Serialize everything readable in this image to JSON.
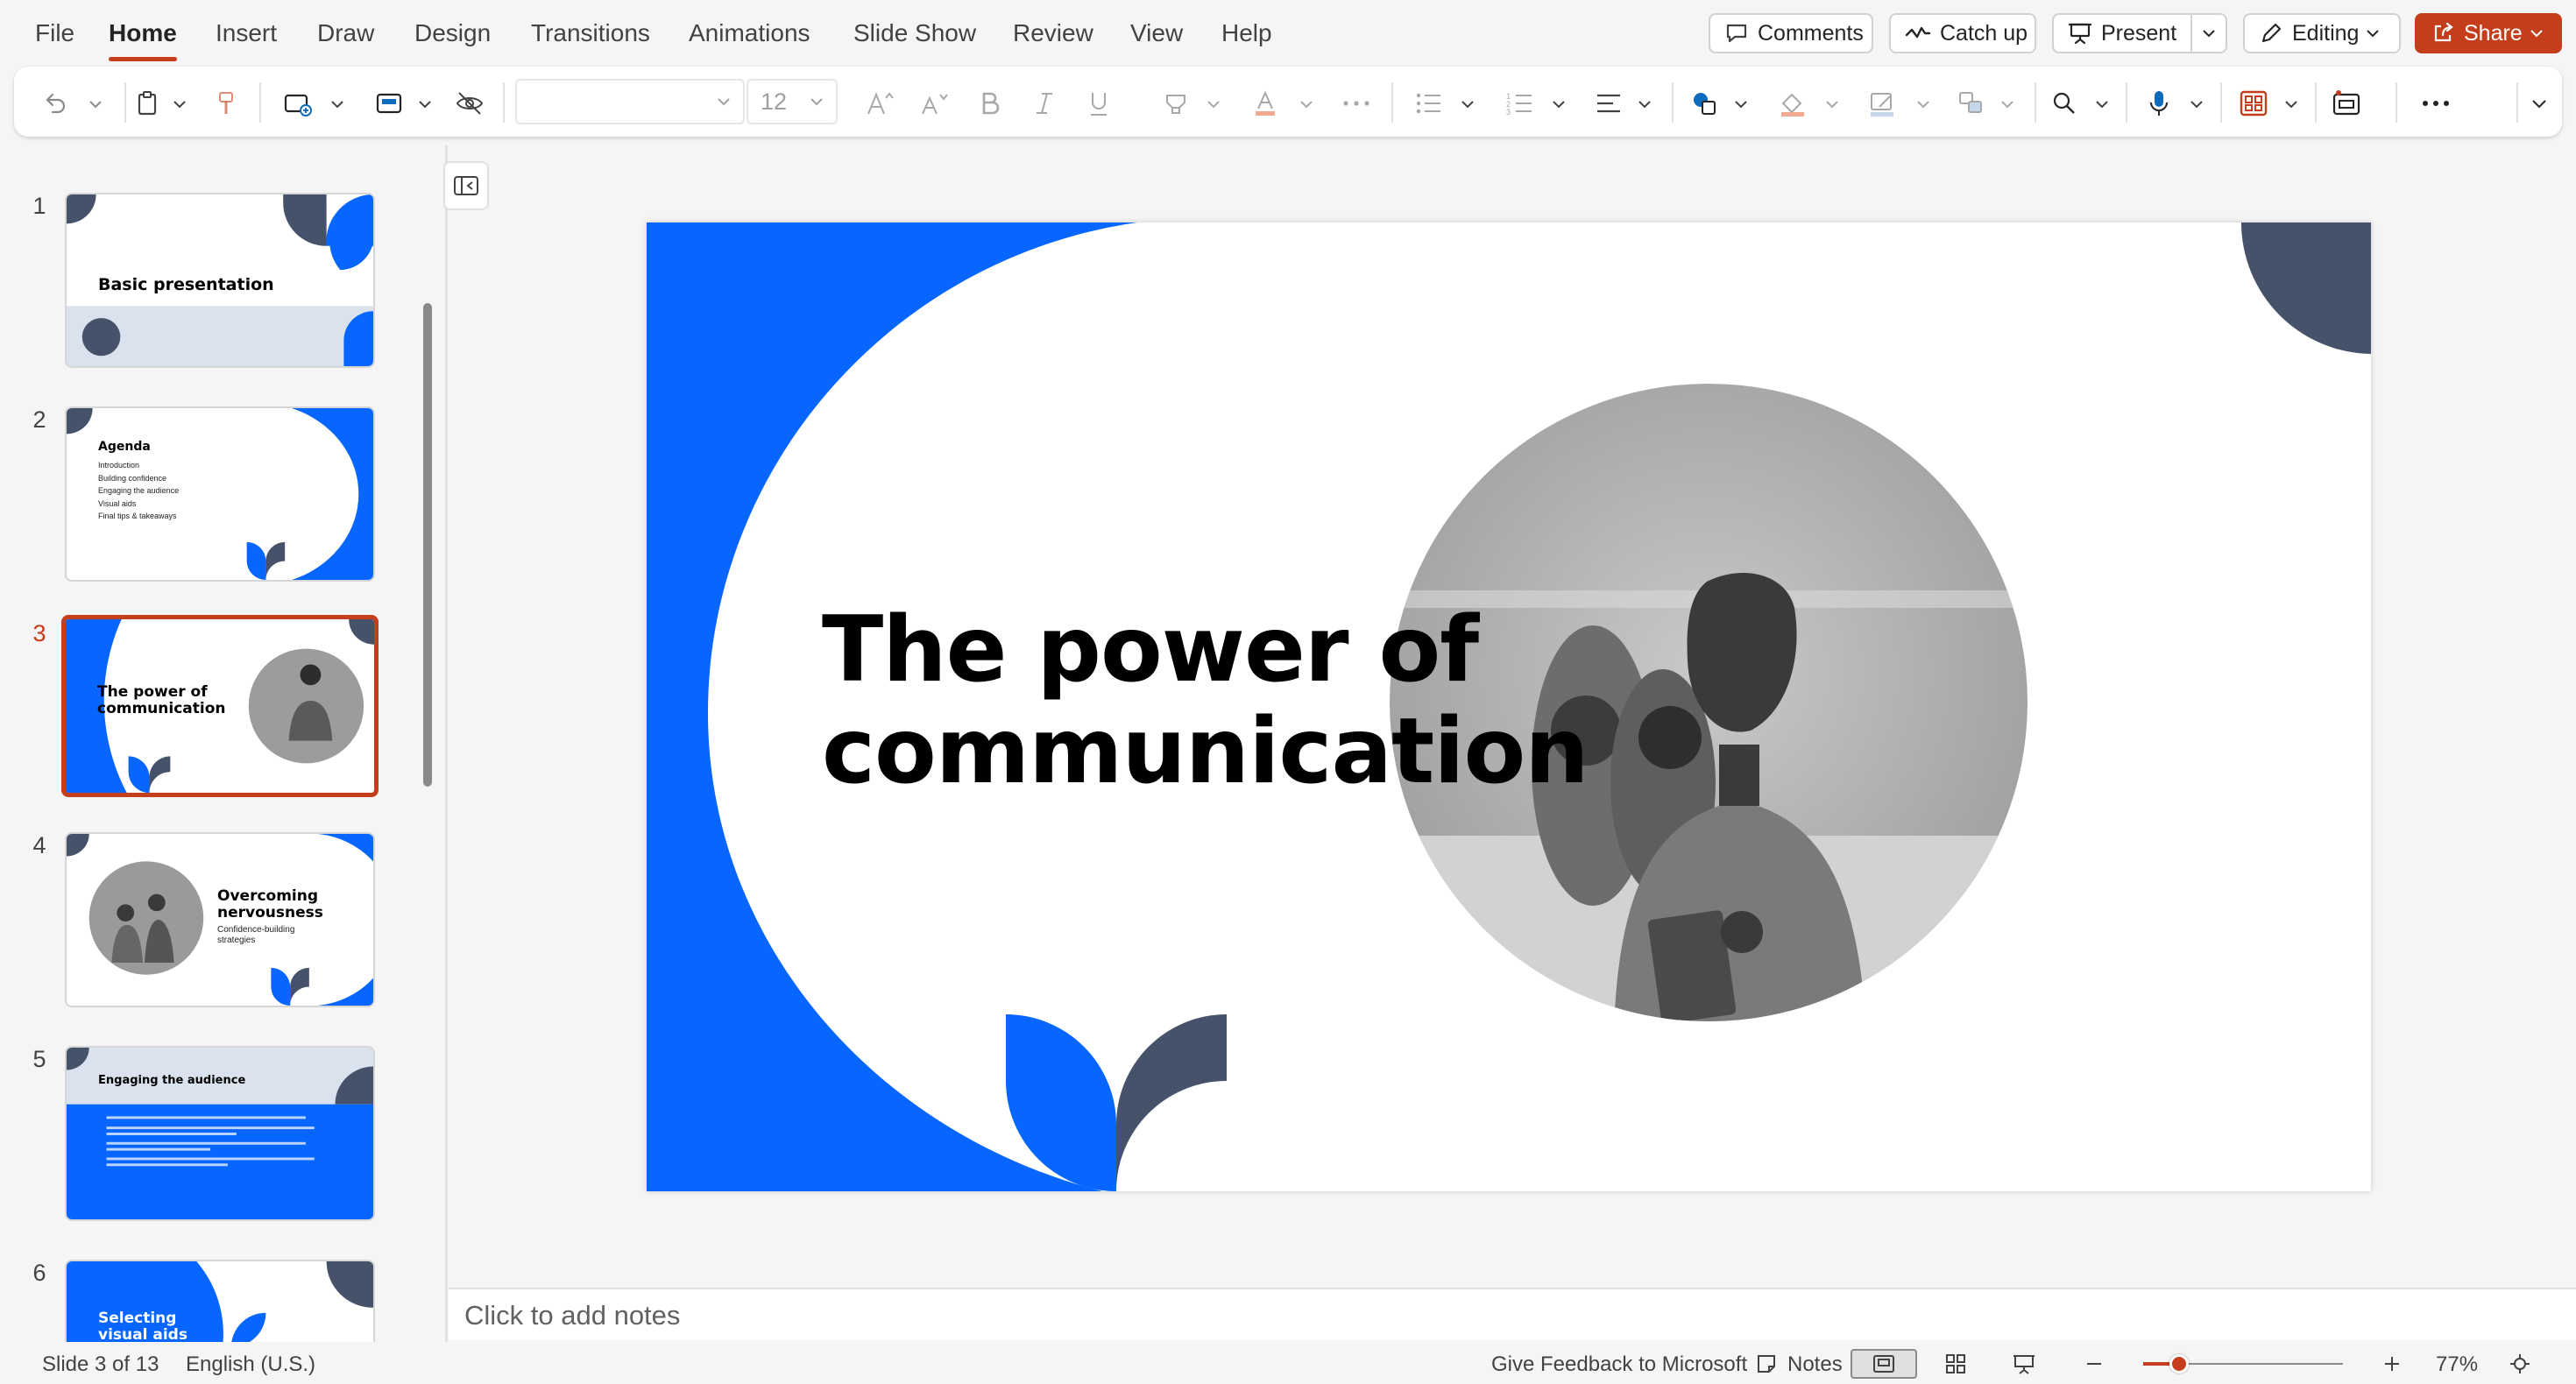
{
  "menu": {
    "tabs": [
      {
        "label": "File"
      },
      {
        "label": "Home"
      },
      {
        "label": "Insert"
      },
      {
        "label": "Draw"
      },
      {
        "label": "Design"
      },
      {
        "label": "Transitions"
      },
      {
        "label": "Animations"
      },
      {
        "label": "Slide Show"
      },
      {
        "label": "Review"
      },
      {
        "label": "View"
      },
      {
        "label": "Help"
      }
    ],
    "active_tab": "Home"
  },
  "top_actions": {
    "comments": "Comments",
    "catch_up": "Catch up",
    "present": "Present",
    "editing": "Editing",
    "share": "Share"
  },
  "ribbon": {
    "font_name": "",
    "font_size": "12"
  },
  "thumbnails": [
    {
      "number": "1",
      "title": "Basic presentation"
    },
    {
      "number": "2",
      "title": "Agenda",
      "bullets": [
        "Introduction",
        "Building confidence",
        "Engaging the audience",
        "Visual aids",
        "Final tips & takeaways"
      ]
    },
    {
      "number": "3",
      "title": "The power of communication",
      "line1": "The power of",
      "line2": "communication"
    },
    {
      "number": "4",
      "title": "Overcoming nervousness",
      "line1": "Overcoming",
      "line2": "nervousness",
      "subtitle1": "Confidence-building",
      "subtitle2": "strategies"
    },
    {
      "number": "5",
      "title": "Engaging the audience"
    },
    {
      "number": "6",
      "title": "Selecting visual aids",
      "line1": "Selecting",
      "line2": "visual aids"
    }
  ],
  "selected_slide": 3,
  "slide": {
    "title_line1": "The power of",
    "title_line2": "communication"
  },
  "notes": {
    "placeholder": "Click to add notes"
  },
  "status": {
    "slide_indicator": "Slide 3 of 13",
    "language": "English (U.S.)",
    "feedback": "Give Feedback to Microsoft",
    "notes_label": "Notes",
    "zoom": "77%",
    "zoom_level_fraction": 0.18
  },
  "colors": {
    "accent": "#c43e1c",
    "slide_blue": "#0766ff",
    "slide_slate": "#45526a"
  },
  "icons": [
    "undo-icon",
    "clipboard-icon",
    "format-painter-icon",
    "new-slide-icon",
    "layout-icon",
    "hide-slide-icon",
    "grow-font-icon",
    "shrink-font-icon",
    "bold-icon",
    "italic-icon",
    "underline-icon",
    "highlight-icon",
    "font-color-icon",
    "more-icon",
    "bullets-icon",
    "numbering-icon",
    "align-icon",
    "shapes-icon",
    "fill-icon",
    "outline-icon",
    "arrange-icon",
    "search-icon",
    "dictate-icon",
    "designer-icon",
    "addin-icon",
    "overflow-icon",
    "comment-icon",
    "catchup-icon",
    "present-icon",
    "pencil-icon",
    "share-icon"
  ]
}
